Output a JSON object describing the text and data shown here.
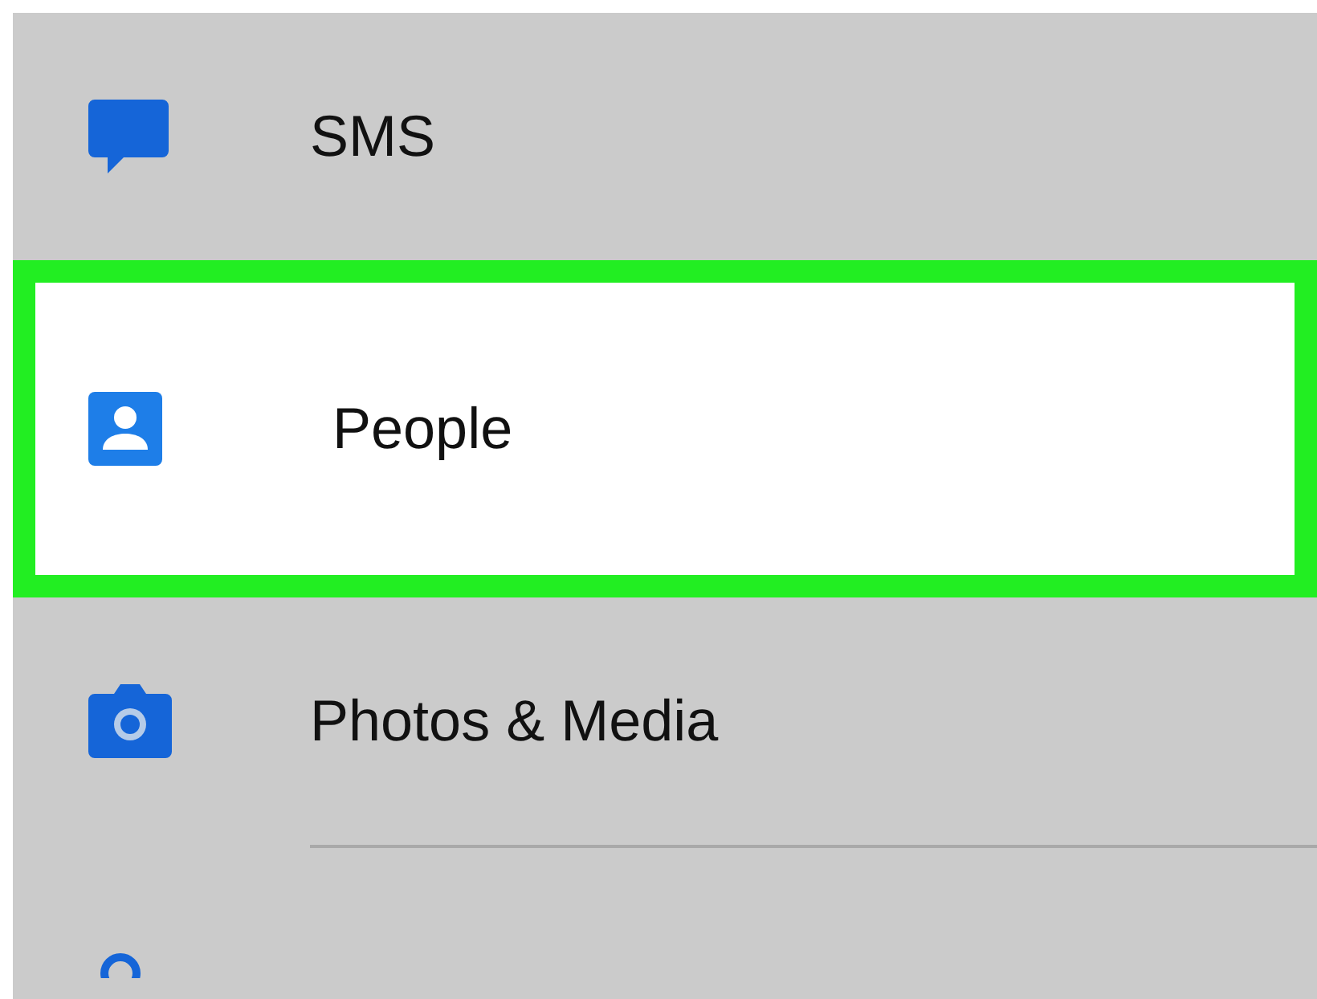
{
  "settings": {
    "items": [
      {
        "kind": "message",
        "label": "SMS",
        "selected": false
      },
      {
        "kind": "contact",
        "label": "People",
        "selected": true
      },
      {
        "kind": "camera",
        "label": "Photos & Media",
        "selected": false
      },
      {
        "kind": "person",
        "selected": false
      }
    ]
  }
}
